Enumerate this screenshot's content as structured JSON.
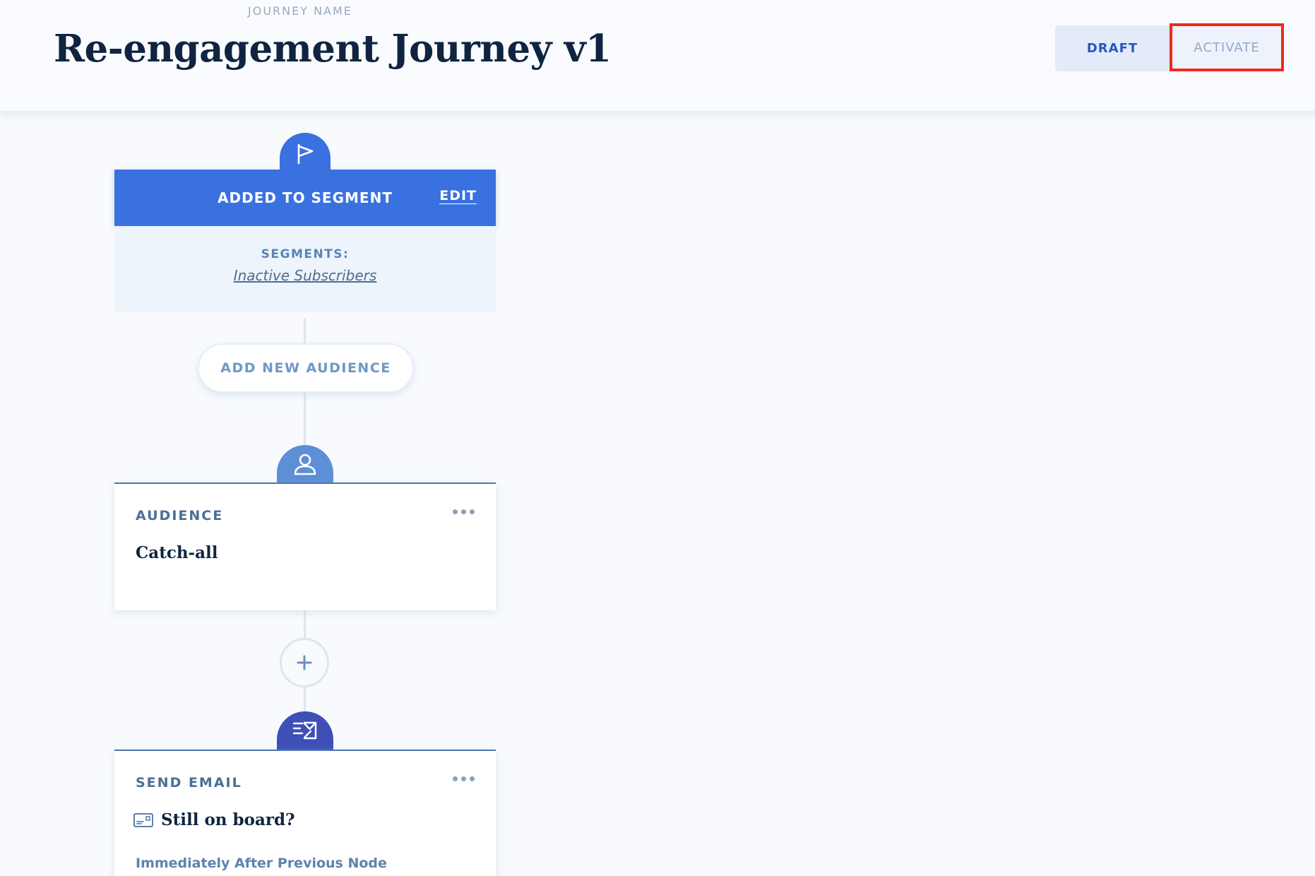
{
  "header": {
    "journey_label": "JOURNEY NAME",
    "title": "Re-engagement Journey v1",
    "draft_label": "DRAFT",
    "activate_label": "ACTIVATE"
  },
  "trigger": {
    "icon": "flag-icon",
    "title": "ADDED TO SEGMENT",
    "edit_label": "EDIT",
    "segments_label": "SEGMENTS:",
    "segment_value": "Inactive Subscribers"
  },
  "add_audience_label": "ADD NEW AUDIENCE",
  "audience_node": {
    "icon": "user-icon",
    "type": "AUDIENCE",
    "name": "Catch-all"
  },
  "add_node_icon": "plus-icon",
  "email_node": {
    "icon": "send-email-icon",
    "type": "SEND EMAIL",
    "name_icon": "email-template-icon",
    "name": "Still on board?",
    "timing": "Immediately After Previous Node"
  },
  "colors": {
    "primary": "#3a71e0",
    "audience": "#5c8fd6",
    "email": "#3e4fb8",
    "highlight": "#ee2a1c"
  }
}
